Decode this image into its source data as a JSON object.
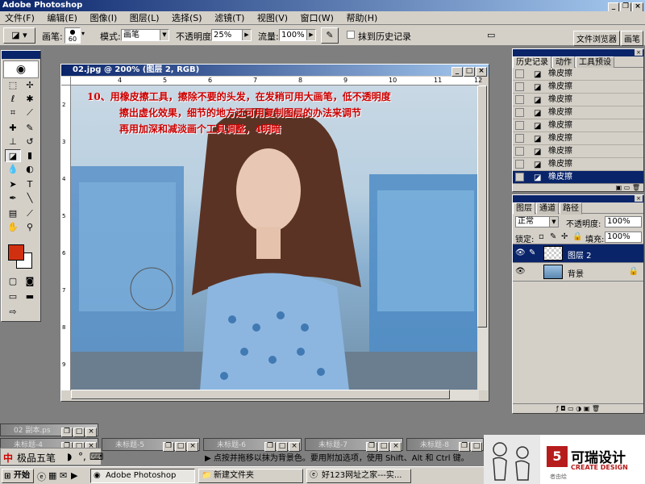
{
  "app": {
    "title": "Adobe Photoshop"
  },
  "menu": [
    "文件(F)",
    "编辑(E)",
    "图像(I)",
    "图层(L)",
    "选择(S)",
    "滤镜(T)",
    "视图(V)",
    "窗口(W)",
    "帮助(H)"
  ],
  "options": {
    "brush_label": "画笔:",
    "brush_size": "60",
    "mode_label": "模式:",
    "mode_value": "画笔",
    "opacity_label": "不透明度:",
    "opacity_value": "25%",
    "flow_label": "流量:",
    "flow_value": "100%",
    "erase_history_label": "抹到历史记录"
  },
  "palette_well": [
    "文件浏览器",
    "画笔"
  ],
  "document": {
    "title": "02.jpg @ 200% (图层 2, RGB)",
    "ruler_h": [
      "4",
      "5",
      "6",
      "7",
      "8",
      "9",
      "10",
      "11",
      "12"
    ],
    "ruler_v": [
      "2",
      "3",
      "4",
      "5",
      "6",
      "7",
      "8",
      "9"
    ],
    "annotation": [
      "10、用橡皮擦工具，擦除不要的头发，在发稍可用大画笔，低不透明度",
      "擦出虚化效果，细节的地方还可用复制图层的办法来调节",
      "再用加深和减淡画个工具调整，4明暗"
    ]
  },
  "history_panel": {
    "tabs": [
      "历史记录",
      "动作",
      "工具预设"
    ],
    "items": [
      "橡皮擦",
      "橡皮擦",
      "橡皮擦",
      "橡皮擦",
      "橡皮擦",
      "橡皮擦",
      "橡皮擦",
      "橡皮擦",
      "橡皮擦"
    ],
    "selected_index": 8
  },
  "layers_panel": {
    "tabs": [
      "图层",
      "通道",
      "路径"
    ],
    "blend_mode": "正常",
    "opacity_label": "不透明度:",
    "opacity_value": "100%",
    "lock_label": "锁定:",
    "fill_label": "填充:",
    "fill_value": "100%",
    "layers": [
      {
        "name": "图层 2",
        "selected": true
      },
      {
        "name": "背景",
        "selected": false,
        "locked": true
      }
    ]
  },
  "minimized_windows": [
    {
      "title": "02 副本.ps"
    },
    {
      "title": "未标题-4"
    },
    {
      "title": "未标题-5"
    },
    {
      "title": "未标题-6"
    },
    {
      "title": "未标题-7"
    },
    {
      "title": "未标题-8"
    }
  ],
  "ime": {
    "name": "极品五笔"
  },
  "status_text": "点按并拖移以抹为背景色。要用附加选项，使用 Shift、Alt 和 Ctrl 键。",
  "taskbar": {
    "start": "开始",
    "items": [
      "Adobe Photoshop",
      "新建文件夹",
      "好123网址之家---实..."
    ]
  },
  "logo": {
    "cn": "可瑞设计",
    "en": "CREATE DESIGN",
    "small": "者由绘"
  },
  "colors": {
    "accent": "#0a246a",
    "foreground": "#d03010",
    "background": "#ffffff",
    "annotation": "#cc0000"
  }
}
